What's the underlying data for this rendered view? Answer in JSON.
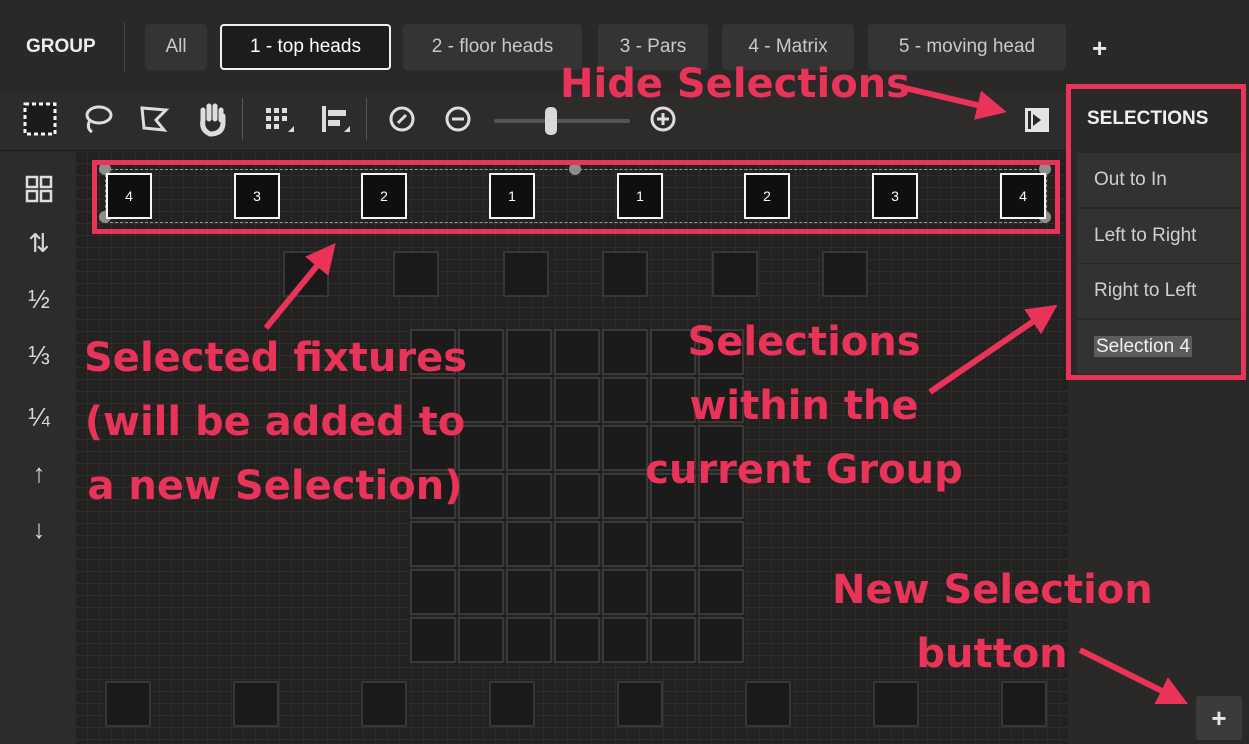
{
  "header": {
    "group_label": "GROUP",
    "tabs": [
      {
        "label": "All",
        "active": false
      },
      {
        "label": "1 - top heads",
        "active": true
      },
      {
        "label": "2 - floor heads",
        "active": false
      },
      {
        "label": "3 - Pars",
        "active": false
      },
      {
        "label": "4 - Matrix",
        "active": false
      },
      {
        "label": "5 - moving head",
        "active": false
      }
    ],
    "add_tab_label": "+"
  },
  "toolbar": {
    "tools": [
      "rect-select-icon",
      "lasso-icon",
      "lasso-polygon-icon",
      "hand-pan-icon",
      "grid-snap-icon",
      "align-icon",
      "zoom-reset-icon",
      "zoom-out-icon",
      "zoom-in-icon",
      "hide-selections-icon"
    ],
    "zoom_level": 0.4
  },
  "left_tools": {
    "labels": [
      "⊞",
      "⇅",
      "½",
      "⅓",
      "¼",
      "↑",
      "↓"
    ],
    "icons": [
      "grid-icon",
      "swap-order-icon",
      "half-icon",
      "third-icon",
      "quarter-icon",
      "arrow-up-icon",
      "arrow-down-icon"
    ]
  },
  "selected_heads": [
    "4",
    "3",
    "2",
    "1",
    "1",
    "2",
    "3",
    "4"
  ],
  "selections_panel": {
    "title": "SELECTIONS",
    "items": [
      "Out to In",
      "Left to Right",
      "Right to Left",
      "Selection 4"
    ],
    "new_button_label": "+"
  },
  "annotations": {
    "hide_selections": "Hide Selections",
    "selected_fixtures": [
      "Selected fixtures",
      "(will be added to",
      "a new Selection)"
    ],
    "selections_within": [
      "Selections",
      "within the",
      "current Group"
    ],
    "new_selection": [
      "New Selection",
      "button"
    ]
  },
  "colors": {
    "annotation_red": "#ea3358",
    "background": "#2a2928",
    "canvas": "#232221"
  }
}
